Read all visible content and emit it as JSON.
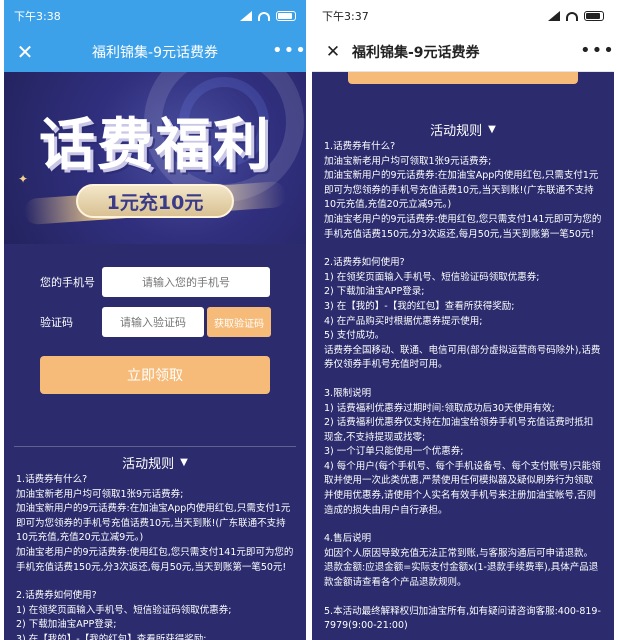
{
  "status": {
    "left_time": "下午3:38",
    "right_time": "下午3:37"
  },
  "nav": {
    "title": "福利锦集-9元话费券",
    "more": "•••",
    "close": "✕"
  },
  "hero": {
    "title": "话费福利",
    "subtitle": "1元充10元"
  },
  "form": {
    "phone_label": "您的手机号",
    "phone_placeholder": "请输入您的手机号",
    "code_label": "验证码",
    "code_placeholder": "请输入验证码",
    "code_button": "获取验证码",
    "submit": "立即领取"
  },
  "rules": {
    "heading": "活动规则",
    "sections": [
      {
        "title": "1.话费券有什么?",
        "lines": [
          "加油宝新老用户均可领取1张9元话费券;",
          "加油宝新用户的9元话费券:在加油宝App内使用红包,只需支付1元即可为您领券的手机号充值话费10元,当天到账!(广东联通不支持10元充值,充值20元立减9元。)",
          "加油宝老用户的9元话费券:使用红包,您只需支付141元即可为您的手机充值话费150元,分3次返还,每月50元,当天到账第一笔50元!"
        ]
      },
      {
        "title": "2.话费券如何使用?",
        "lines": [
          "1) 在领奖页面输入手机号、短信验证码领取优惠券;",
          "2) 下载加油宝APP登录;",
          "3) 在【我的】-【我的红包】查看所获得奖励;",
          "4) 在产品购买时根据优惠券提示使用;",
          "5) 支付成功。",
          "话费券全国移动、联通、电信可用(部分虚拟运营商号码除外),话费券仅领券手机号充值时可用。"
        ]
      },
      {
        "title": "3.限制说明",
        "lines": [
          "1) 话费福利优惠券过期时间:领取成功后30天使用有效;",
          "2) 话费福利优惠券仅支持在加油宝给领券手机号充值话费时抵扣现金,不支持提现或找零;",
          "3) 一个订单只能使用一个优惠券;",
          "4) 每个用户(每个手机号、每个手机设备号、每个支付账号)只能领取并使用一次此类优惠,严禁使用任何模拟器及疑似刷券行为领取并使用优惠券,请使用个人实名有效手机号来注册加油宝帐号,否则造成的损失由用户自行承担。"
        ]
      },
      {
        "title": "4.售后说明",
        "lines": [
          "如因个人原因导致充值无法正常到账,与客服沟通后可申请退款。",
          "退款金额:应退金额=实际支付金额x(1-退款手续费率),具体产品退款金额请查看各个产品退款规则。"
        ]
      },
      {
        "title": "",
        "lines": [
          "5.本活动最终解释权归加油宝所有,如有疑问请咨询客服:400-819-7979(9:00-21:00)"
        ]
      }
    ]
  },
  "colors": {
    "header_blue": "#3da1ea",
    "page_bg": "#2b2b6e",
    "button_orange": "#f6bb79"
  },
  "icons": [
    "signal-icon",
    "wifi-icon",
    "battery-icon",
    "close-icon",
    "more-icon",
    "chevron-down-icon"
  ]
}
